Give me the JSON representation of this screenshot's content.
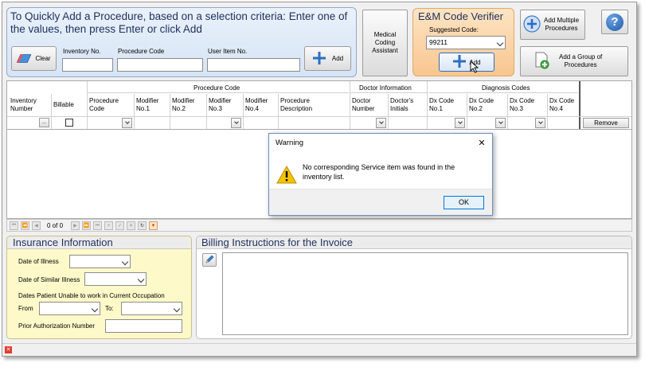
{
  "quick_add": {
    "title_line1": "To Quickly Add a Procedure, based on a selection criteria: Enter one of",
    "title_line2": "the values, then press Enter or click Add",
    "clear_label": "Clear",
    "inventory_no_label": "Inventory No.",
    "procedure_code_label": "Procedure Code",
    "user_item_no_label": "User Item No.",
    "add_label": "Add"
  },
  "medical_coding": {
    "line1": "Medical",
    "line2": "Coding",
    "line3": "Assistant"
  },
  "em_verifier": {
    "title": "E&M Code Verifier",
    "suggested_label": "Suggested Code:",
    "suggested_value": "99211",
    "add_label": "Add"
  },
  "add_multiple": {
    "line1": "Add Multiple",
    "line2": "Procedures"
  },
  "add_group": {
    "line1": "Add a Group of",
    "line2": "Procedures"
  },
  "help": {
    "label": "?"
  },
  "grid": {
    "group_procedure": "Procedure Code",
    "group_doctor": "Doctor Information",
    "group_diagnosis": "Diagnosis Codes",
    "col_inventory_1": "Inventory",
    "col_inventory_2": "Number",
    "col_billable": "Billable",
    "col_proc_1": "Procedure",
    "col_proc_2": "Code",
    "col_mod1_1": "Modifier",
    "col_mod1_2": "No.1",
    "col_mod2_1": "Modifier",
    "col_mod2_2": "No.2",
    "col_mod3_1": "Modifier",
    "col_mod3_2": "No.3",
    "col_mod4_1": "Modifier",
    "col_mod4_2": "No.4",
    "col_desc_1": "Procedure",
    "col_desc_2": "Description",
    "col_docno_1": "Doctor",
    "col_docno_2": "Number",
    "col_docinit_1": "Doctor's",
    "col_docinit_2": "Initials",
    "col_dx1_1": "Dx Code",
    "col_dx1_2": "No.1",
    "col_dx2_1": "Dx Code",
    "col_dx2_2": "No.2",
    "col_dx3_1": "Dx Code",
    "col_dx3_2": "No.3",
    "col_dx4_1": "Dx Code",
    "col_dx4_2": "No.4",
    "ellipsis": "...",
    "remove_label": "Remove",
    "pager_text": "0 of 0"
  },
  "dialog": {
    "title": "Warning",
    "close": "✕",
    "message_line1": "No corresponding Service item was found in the",
    "message_line2": "inventory list.",
    "ok_label": "OK"
  },
  "insurance": {
    "title": "Insurance Information",
    "date_of_illness": "Date of Illness",
    "date_similar": "Date of Similar Illness",
    "dates_unable": "Dates Patient Unable to work in Current Occupation",
    "from_label": "From",
    "to_label": "To:",
    "prior_auth": "Prior Authorization Number"
  },
  "billing": {
    "title": "Billing Instructions for the Invoice"
  },
  "colors": {
    "panel_blue": "#dfeaf7",
    "em_orange": "#fbd3a6",
    "insurance_yellow": "#fdf9c9",
    "warning_yellow": "#f5c400"
  }
}
